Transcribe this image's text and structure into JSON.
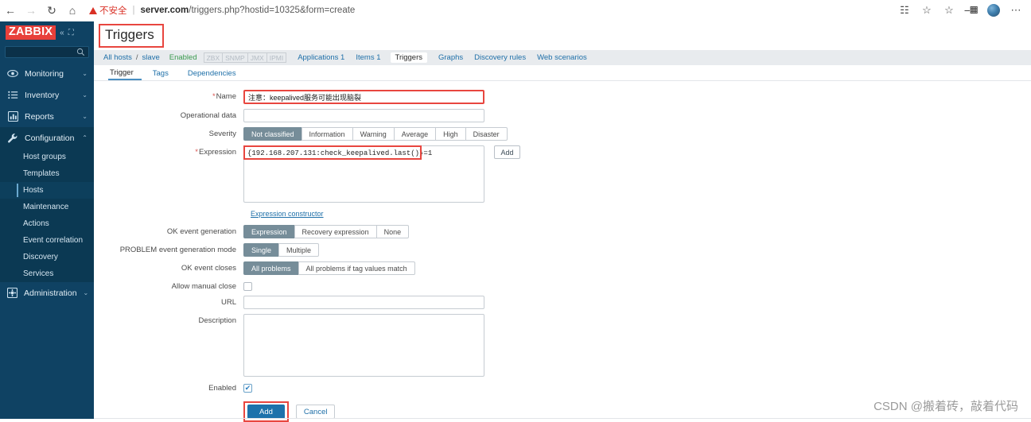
{
  "browser": {
    "back_icon": "back-arrow-icon",
    "forward_icon": "forward-arrow-icon",
    "reload_icon": "reload-icon",
    "home_icon": "home-icon",
    "security_label": "不安全",
    "url_host": "server.com",
    "url_path": "/triggers.php?hostid=10325&form=create",
    "actions": [
      {
        "name": "read-aloud-icon",
        "glyph": "☷"
      },
      {
        "name": "favorite-star-icon",
        "glyph": "☆"
      },
      {
        "name": "add-favorites-icon",
        "glyph": "☆"
      },
      {
        "name": "collections-icon",
        "glyph": "⛿"
      },
      {
        "name": "profile-avatar",
        "glyph": ""
      },
      {
        "name": "more-settings-icon",
        "glyph": "⋯"
      }
    ]
  },
  "sidebar": {
    "logo": "ZABBIX",
    "collapse_icon": "«",
    "expand_icon": "⛶",
    "search_placeholder": "",
    "groups": [
      {
        "label": "Monitoring",
        "icon": "eye-icon",
        "caret": "⌄",
        "active": false
      },
      {
        "label": "Inventory",
        "icon": "list-icon",
        "caret": "⌄",
        "active": false
      },
      {
        "label": "Reports",
        "icon": "bar-chart-icon",
        "caret": "⌄",
        "active": false
      },
      {
        "label": "Configuration",
        "icon": "wrench-icon",
        "caret": "⌃",
        "active": true
      }
    ],
    "config_items": [
      {
        "label": "Host groups",
        "selected": false
      },
      {
        "label": "Templates",
        "selected": false
      },
      {
        "label": "Hosts",
        "selected": true
      },
      {
        "label": "Maintenance",
        "selected": false
      },
      {
        "label": "Actions",
        "selected": false
      },
      {
        "label": "Event correlation",
        "selected": false
      },
      {
        "label": "Discovery",
        "selected": false
      },
      {
        "label": "Services",
        "selected": false
      }
    ],
    "admin": {
      "label": "Administration",
      "icon": "gear-icon",
      "caret": "⌄"
    }
  },
  "page": {
    "title": "Triggers"
  },
  "breadcrumb": {
    "all_hosts": "All hosts",
    "separator": "/",
    "host": "slave",
    "status": "Enabled",
    "protocols": [
      "ZBX",
      "SNMP",
      "JMX",
      "IPMI"
    ],
    "links": [
      {
        "label": "Applications 1",
        "current": false
      },
      {
        "label": "Items 1",
        "current": false
      },
      {
        "label": "Triggers",
        "current": true
      },
      {
        "label": "Graphs",
        "current": false
      },
      {
        "label": "Discovery rules",
        "current": false
      },
      {
        "label": "Web scenarios",
        "current": false
      }
    ]
  },
  "form_tabs": [
    {
      "label": "Trigger",
      "active": true
    },
    {
      "label": "Tags",
      "active": false
    },
    {
      "label": "Dependencies",
      "active": false
    }
  ],
  "form": {
    "name": {
      "label": "Name",
      "required": true,
      "value": "注意：keepalived服务可能出现脑裂",
      "placeholder": "",
      "highlighted": true
    },
    "operational_data": {
      "label": "Operational data",
      "value": "",
      "placeholder": ""
    },
    "severity": {
      "label": "Severity",
      "options": [
        "Not classified",
        "Information",
        "Warning",
        "Average",
        "High",
        "Disaster"
      ],
      "selected": "Not classified"
    },
    "expression": {
      "label": "Expression",
      "required": true,
      "value": "{192.168.207.131:check_keepalived.last()}=1",
      "add_button": "Add",
      "highlighted": true
    },
    "expression_constructor": "Expression constructor",
    "ok_event_generation": {
      "label": "OK event generation",
      "options": [
        "Expression",
        "Recovery expression",
        "None"
      ],
      "selected": "Expression"
    },
    "problem_event_mode": {
      "label": "PROBLEM event generation mode",
      "options": [
        "Single",
        "Multiple"
      ],
      "selected": "Single"
    },
    "ok_event_closes": {
      "label": "OK event closes",
      "options": [
        "All problems",
        "All problems if tag values match"
      ],
      "selected": "All problems"
    },
    "allow_manual_close": {
      "label": "Allow manual close",
      "checked": false
    },
    "url": {
      "label": "URL",
      "value": "",
      "placeholder": ""
    },
    "description": {
      "label": "Description",
      "value": "",
      "placeholder": ""
    },
    "enabled": {
      "label": "Enabled",
      "checked": true
    },
    "submit": "Add",
    "cancel": "Cancel"
  },
  "watermark": "CSDN @搬着砖，敲着代码",
  "colors": {
    "brand_red": "#e8403a",
    "sidebar_bg": "#0f4263",
    "accent_blue": "#1d72ab",
    "link_blue": "#1e6fa8",
    "highlight_red": "#e8463f",
    "segment_on": "#768d99",
    "enabled_green": "#3a9a4e"
  }
}
